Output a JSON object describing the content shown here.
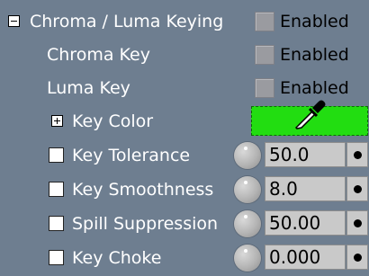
{
  "section": {
    "title": "Chroma / Luma Keying",
    "enabled_label": "Enabled"
  },
  "chroma_key": {
    "label": "Chroma Key",
    "enabled_label": "Enabled"
  },
  "luma_key": {
    "label": "Luma Key",
    "enabled_label": "Enabled"
  },
  "key_color": {
    "label": "Key Color",
    "color": "#22dd11",
    "icon": "eyedropper-icon"
  },
  "params": [
    {
      "label": "Key Tolerance",
      "value": "50.0"
    },
    {
      "label": "Key Smoothness",
      "value": "8.0"
    },
    {
      "label": "Spill Suppression",
      "value": "50.00"
    },
    {
      "label": "Key Choke",
      "value": "0.000"
    }
  ],
  "colors": {
    "panel_bg": "#6e7e90",
    "label_text": "#ffffff",
    "checkbox_bg": "#9a9ba0",
    "field_bg": "#c9c9c9"
  }
}
